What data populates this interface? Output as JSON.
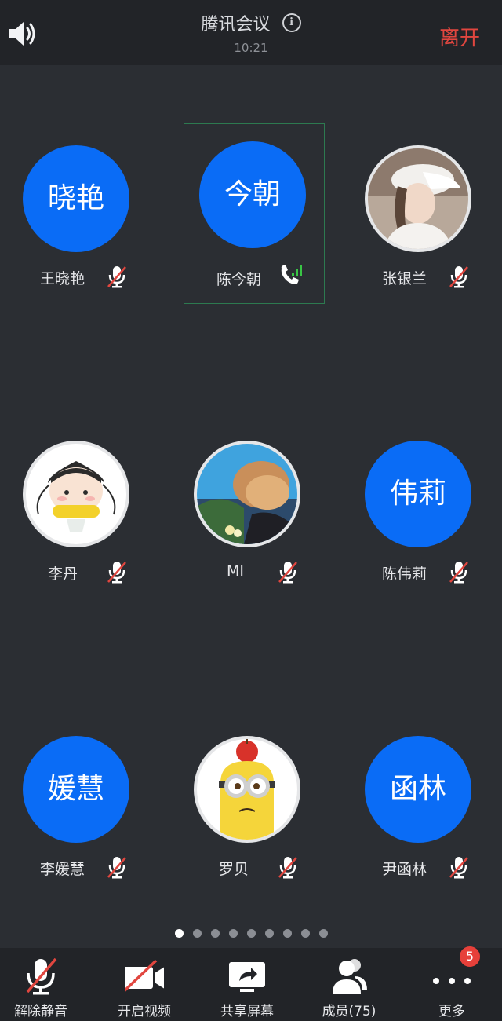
{
  "header": {
    "title": "腾讯会议",
    "time": "10:21",
    "leave_label": "离开",
    "info_glyph": "i"
  },
  "participants": [
    {
      "name": "王晓艳",
      "avatar_text": "晓艳",
      "status": "mic-off-icon"
    },
    {
      "name": "陈今朝",
      "avatar_text": "今朝",
      "status": "phone-signal-icon",
      "speaking": true
    },
    {
      "name": "张银兰",
      "avatar_text": "",
      "status": "mic-off-icon",
      "photo": "girl-cap-photo"
    },
    {
      "name": "李丹",
      "avatar_text": "",
      "status": "mic-off-icon",
      "photo": "cartoon-girl-photo"
    },
    {
      "name": "MI",
      "avatar_text": "",
      "status": "mic-off-icon",
      "photo": "landscape-photo"
    },
    {
      "name": "陈伟莉",
      "avatar_text": "伟莉",
      "status": "mic-off-icon"
    },
    {
      "name": "李媛慧",
      "avatar_text": "媛慧",
      "status": "mic-off-icon"
    },
    {
      "name": "罗贝",
      "avatar_text": "",
      "status": "mic-off-icon",
      "photo": "minion-photo"
    },
    {
      "name": "尹函林",
      "avatar_text": "函林",
      "status": "mic-off-icon"
    }
  ],
  "pagination": {
    "total": 9,
    "current": 1
  },
  "toolbar": {
    "unmute_label": "解除静音",
    "video_label": "开启视频",
    "share_label": "共享屏幕",
    "members_label": "成员(75)",
    "more_label": "更多",
    "more_badge": "5"
  },
  "colors": {
    "background": "#2b2e33",
    "bar": "#222428",
    "avatar_blue": "#0a6cf6",
    "leave_red": "#e1463f",
    "signal_green": "#39c545",
    "badge_red": "#e6403a"
  }
}
